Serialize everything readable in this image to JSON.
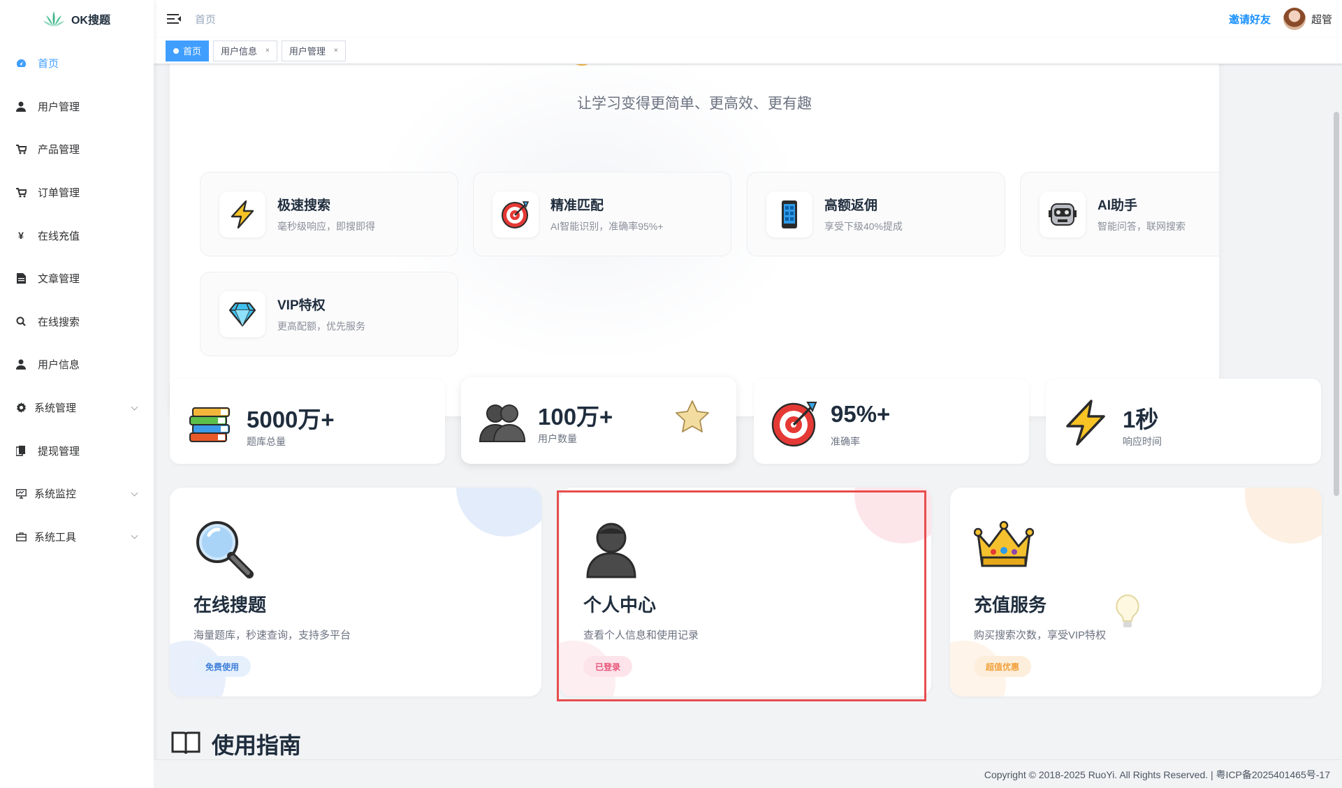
{
  "app": {
    "title": "OK搜题"
  },
  "sidebar": {
    "items": [
      {
        "label": "首页",
        "icon": "dashboard-icon"
      },
      {
        "label": "用户管理",
        "icon": "user-icon"
      },
      {
        "label": "产品管理",
        "icon": "cart-icon"
      },
      {
        "label": "订单管理",
        "icon": "cart-icon"
      },
      {
        "label": "在线充值",
        "icon": "yen-icon"
      },
      {
        "label": "文章管理",
        "icon": "document-icon"
      },
      {
        "label": "在线搜索",
        "icon": "search-icon"
      },
      {
        "label": "用户信息",
        "icon": "user-icon"
      },
      {
        "label": "系统管理",
        "icon": "gear-icon"
      },
      {
        "label": "提现管理",
        "icon": "clipboard-icon"
      },
      {
        "label": "系统监控",
        "icon": "monitor-icon"
      },
      {
        "label": "系统工具",
        "icon": "toolbox-icon"
      }
    ]
  },
  "header": {
    "breadcrumb": "首页",
    "invite_label": "邀请好友",
    "username": "超管"
  },
  "tags": [
    {
      "label": "首页"
    },
    {
      "label": "用户信息",
      "close": "×"
    },
    {
      "label": "用户管理",
      "close": "×"
    }
  ],
  "hero": {
    "subtitle": "让学习变得更简单、更高效、更有趣"
  },
  "features": [
    {
      "title": "极速搜索",
      "desc": "毫秒级响应，即搜即得",
      "icon": "lightning-icon"
    },
    {
      "title": "精准匹配",
      "desc": "AI智能识别，准确率95%+",
      "icon": "target-icon"
    },
    {
      "title": "高额返佣",
      "desc": "享受下级40%提成",
      "icon": "phone-icon"
    },
    {
      "title": "AI助手",
      "desc": "智能问答，联网搜索",
      "icon": "robot-icon"
    },
    {
      "title": "VIP特权",
      "desc": "更高配额，优先服务",
      "icon": "diamond-icon"
    }
  ],
  "stats": [
    {
      "value": "5000万+",
      "label": "题库总量",
      "icon": "books-icon"
    },
    {
      "value": "100万+",
      "label": "用户数量",
      "icon": "users-icon"
    },
    {
      "value": "95%+",
      "label": "准确率",
      "icon": "target-icon"
    },
    {
      "value": "1秒",
      "label": "响应时间",
      "icon": "lightning-icon"
    }
  ],
  "cards": [
    {
      "title": "在线搜题",
      "desc": "海量题库，秒速查询，支持多平台",
      "badge": "免费使用",
      "icon": "magnifier-icon"
    },
    {
      "title": "个人中心",
      "desc": "查看个人信息和使用记录",
      "badge": "已登录",
      "icon": "person-icon"
    },
    {
      "title": "充值服务",
      "desc": "购买搜索次数，享受VIP特权",
      "badge": "超值优惠",
      "icon": "crown-icon"
    }
  ],
  "guide": {
    "title": "使用指南"
  },
  "footer": {
    "copyright": "Copyright © 2018-2025 RuoYi. All Rights Reserved. | 粤ICP备2025401465号-17"
  },
  "colors": {
    "accent": "#409eff",
    "invite": "#1890ff",
    "highlight": "#e84d4d",
    "text": "#1f2d3d"
  }
}
